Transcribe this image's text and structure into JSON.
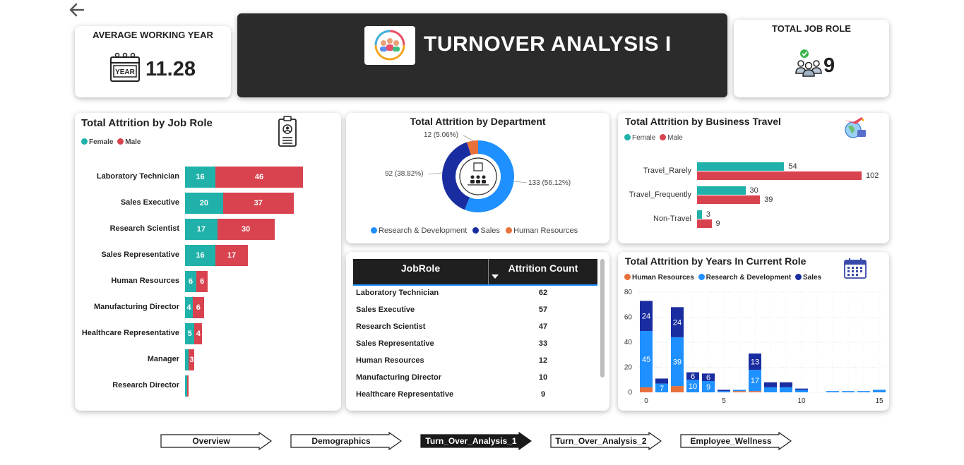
{
  "kpis": {
    "avg_working_year_title": "AVERAGE WORKING YEAR",
    "avg_working_year_value": "11.28",
    "calendar_label": "YEAR",
    "total_job_role_title": "TOTAL JOB ROLE",
    "total_job_role_value": "9"
  },
  "banner": {
    "title": "TURNOVER ANALYSIS I"
  },
  "job_role_card": {
    "title": "Total Attrition by Job Role",
    "legend": [
      "Female",
      "Male"
    ]
  },
  "department_card": {
    "title": "Total Attrition by Department",
    "labels": [
      "133 (56.12%)",
      "92 (38.82%)",
      "12 (5.06%)"
    ],
    "legend": [
      "Research & Development",
      "Sales",
      "Human Resources"
    ]
  },
  "travel_card": {
    "title": "Total Attrition by Business Travel",
    "legend": [
      "Female",
      "Male"
    ]
  },
  "table": {
    "headers": [
      "JobRole",
      "Attrition Count"
    ],
    "rows": [
      [
        "Laboratory Technician",
        "62"
      ],
      [
        "Sales Executive",
        "57"
      ],
      [
        "Research Scientist",
        "47"
      ],
      [
        "Sales Representative",
        "33"
      ],
      [
        "Human Resources",
        "12"
      ],
      [
        "Manufacturing Director",
        "10"
      ],
      [
        "Healthcare Representative",
        "9"
      ]
    ]
  },
  "years_card": {
    "title": "Total Attrition by Years In Current Role",
    "legend": [
      "Human Resources",
      "Research & Development",
      "Sales"
    ]
  },
  "nav": [
    "Overview",
    "Demographics",
    "Turn_Over_Analysis_1",
    "Turn_Over_Analysis_2",
    "Employee_Wellness"
  ],
  "colors": {
    "female": "#20b2aa",
    "male": "#d9434f",
    "rd": "#1e90ff",
    "sales": "#1a2da0",
    "hr": "#e8703a",
    "banner": "#2b2b2b"
  },
  "chart_data": [
    {
      "type": "bar",
      "orientation": "horizontal",
      "stacked": true,
      "title": "Total Attrition by Job Role",
      "categories": [
        "Laboratory Technician",
        "Sales Executive",
        "Research Scientist",
        "Sales Representative",
        "Human Resources",
        "Manufacturing Director",
        "Healthcare Representative",
        "Manager",
        "Research Director"
      ],
      "series": [
        {
          "name": "Female",
          "values": [
            16,
            20,
            17,
            16,
            6,
            4,
            5,
            2,
            1
          ]
        },
        {
          "name": "Male",
          "values": [
            46,
            37,
            30,
            17,
            6,
            6,
            4,
            3,
            1
          ]
        }
      ],
      "legend": "top-left"
    },
    {
      "type": "pie",
      "donut": true,
      "title": "Total Attrition by Department",
      "categories": [
        "Research & Development",
        "Sales",
        "Human Resources"
      ],
      "values": [
        133,
        92,
        12
      ],
      "legend": "bottom"
    },
    {
      "type": "bar",
      "orientation": "horizontal",
      "title": "Total Attrition by Business Travel",
      "categories": [
        "Travel_Rarely",
        "Travel_Frequently",
        "Non-Travel"
      ],
      "series": [
        {
          "name": "Female",
          "values": [
            54,
            30,
            3
          ]
        },
        {
          "name": "Male",
          "values": [
            102,
            39,
            9
          ]
        }
      ],
      "legend": "top-left"
    },
    {
      "type": "bar",
      "stacked": true,
      "title": "Total Attrition by Years In Current Role",
      "x": [
        0,
        1,
        2,
        3,
        4,
        5,
        6,
        7,
        8,
        9,
        10,
        11,
        12,
        13,
        14,
        15
      ],
      "series": [
        {
          "name": "Human Resources",
          "values": [
            4,
            0,
            5,
            0,
            0,
            0,
            1,
            1,
            0,
            0,
            0,
            0,
            0,
            0,
            0,
            0
          ]
        },
        {
          "name": "Research & Development",
          "values": [
            45,
            7,
            39,
            10,
            9,
            1,
            1,
            17,
            4,
            4,
            2,
            0,
            1,
            1,
            1,
            2
          ]
        },
        {
          "name": "Sales",
          "values": [
            24,
            4,
            24,
            6,
            6,
            1,
            0,
            13,
            4,
            4,
            1,
            0,
            0,
            0,
            0,
            0
          ]
        }
      ],
      "xticks": [
        0,
        5,
        10,
        15
      ],
      "yticks": [
        0,
        20,
        40,
        60,
        80
      ],
      "ylim": [
        0,
        80
      ],
      "grid": true,
      "legend": "top-left"
    }
  ]
}
